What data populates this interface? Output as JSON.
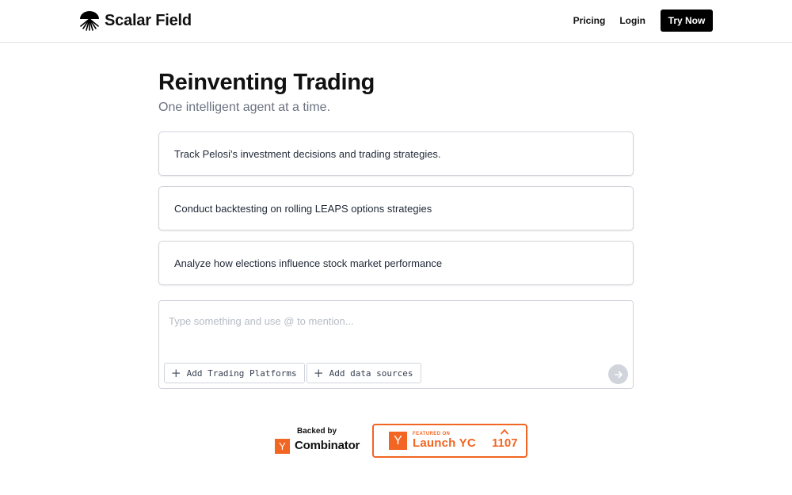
{
  "brand": {
    "name": "Scalar Field",
    "logo_icon": "radial-burst-icon"
  },
  "nav": {
    "pricing_label": "Pricing",
    "login_label": "Login",
    "try_label": "Try Now"
  },
  "hero": {
    "title": "Reinventing Trading",
    "subtitle": "One intelligent agent at a time."
  },
  "suggestions": [
    {
      "text": "Track Pelosi's investment decisions and trading strategies."
    },
    {
      "text": "Conduct backtesting on rolling LEAPS options strategies"
    },
    {
      "text": "Analyze how elections influence stock market performance"
    }
  ],
  "prompt": {
    "placeholder": "Type something and use @ to mention...",
    "value": "",
    "chips": [
      {
        "label": "Add Trading Platforms",
        "icon": "plus-icon"
      },
      {
        "label": "Add data sources",
        "icon": "plus-icon"
      }
    ],
    "send_icon": "arrow-right-icon"
  },
  "backers": {
    "backed_by_label": "Backed by",
    "yc_glyph": "Y",
    "combinator_label": "Combinator",
    "launch_badge": {
      "glyph": "Y",
      "featured_label": "FEATURED ON",
      "title": "Launch YC",
      "upvote_icon": "caret-up-icon",
      "count": "1107"
    }
  },
  "colors": {
    "brand_black": "#000000",
    "yc_orange": "#f26522",
    "muted_text": "#6b7280",
    "border": "#d1d5db"
  }
}
